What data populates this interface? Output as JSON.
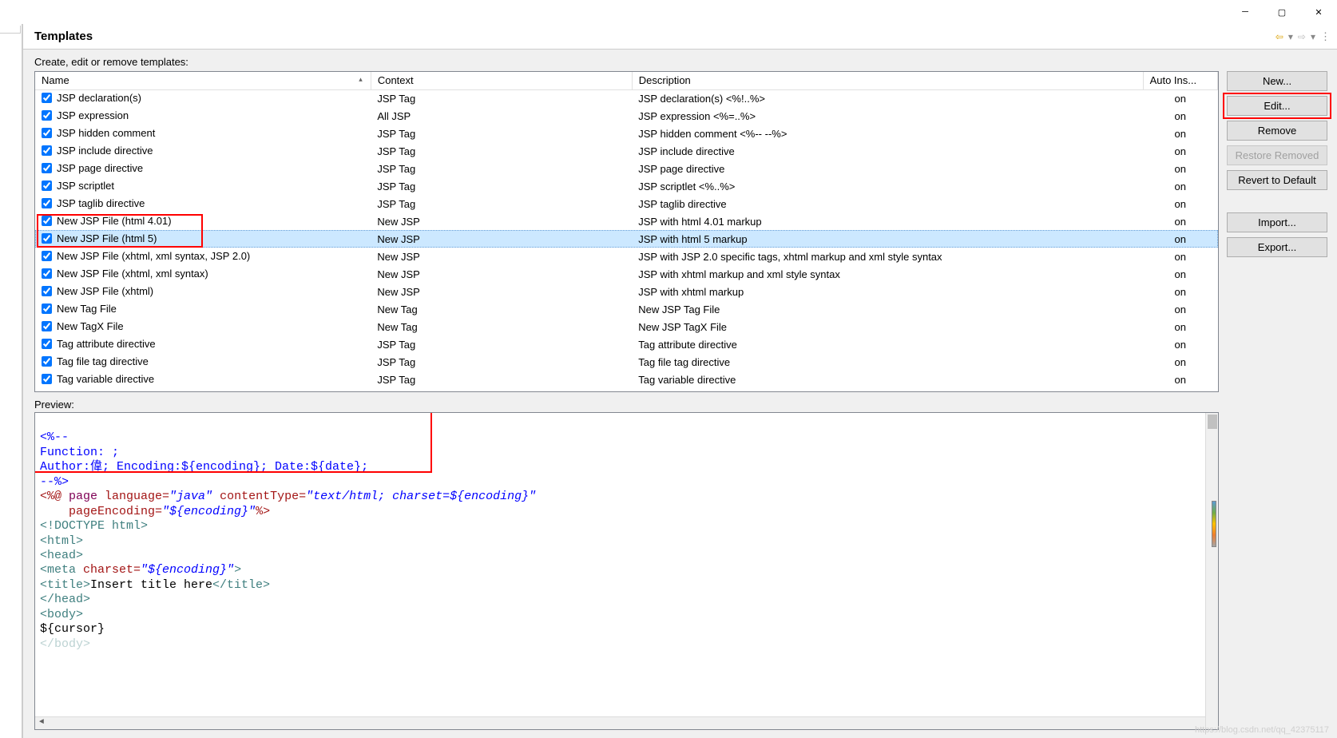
{
  "window": {
    "minimize": "─",
    "maximize": "▢",
    "close": "✕"
  },
  "header": {
    "title": "Templates"
  },
  "instruction": "Create, edit or remove templates:",
  "columns": {
    "name": "Name",
    "context": "Context",
    "description": "Description",
    "autoins": "Auto Ins..."
  },
  "rows": [
    {
      "checked": true,
      "name": "JSP declaration(s)",
      "context": "JSP Tag",
      "description": "JSP declaration(s) <%!..%>",
      "auto": "on",
      "selected": false
    },
    {
      "checked": true,
      "name": "JSP expression",
      "context": "All JSP",
      "description": "JSP expression <%=..%>",
      "auto": "on",
      "selected": false
    },
    {
      "checked": true,
      "name": "JSP hidden comment",
      "context": "JSP Tag",
      "description": "JSP hidden comment <%-- --%>",
      "auto": "on",
      "selected": false
    },
    {
      "checked": true,
      "name": "JSP include directive",
      "context": "JSP Tag",
      "description": "JSP include directive",
      "auto": "on",
      "selected": false
    },
    {
      "checked": true,
      "name": "JSP page directive",
      "context": "JSP Tag",
      "description": "JSP page directive",
      "auto": "on",
      "selected": false
    },
    {
      "checked": true,
      "name": "JSP scriptlet",
      "context": "JSP Tag",
      "description": "JSP scriptlet <%..%>",
      "auto": "on",
      "selected": false
    },
    {
      "checked": true,
      "name": "JSP taglib directive",
      "context": "JSP Tag",
      "description": "JSP taglib directive",
      "auto": "on",
      "selected": false
    },
    {
      "checked": true,
      "name": "New JSP File (html 4.01)",
      "context": "New JSP",
      "description": "JSP with html 4.01 markup",
      "auto": "on",
      "selected": false
    },
    {
      "checked": true,
      "name": "New JSP File (html 5)",
      "context": "New JSP",
      "description": "JSP with html 5 markup",
      "auto": "on",
      "selected": true
    },
    {
      "checked": true,
      "name": "New JSP File (xhtml, xml syntax, JSP 2.0)",
      "context": "New JSP",
      "description": "JSP with JSP 2.0 specific tags, xhtml markup and xml style syntax",
      "auto": "on",
      "selected": false
    },
    {
      "checked": true,
      "name": "New JSP File (xhtml, xml syntax)",
      "context": "New JSP",
      "description": "JSP with xhtml markup and xml style syntax",
      "auto": "on",
      "selected": false
    },
    {
      "checked": true,
      "name": "New JSP File (xhtml)",
      "context": "New JSP",
      "description": "JSP with xhtml markup",
      "auto": "on",
      "selected": false
    },
    {
      "checked": true,
      "name": "New Tag File",
      "context": "New Tag",
      "description": "New JSP Tag File",
      "auto": "on",
      "selected": false
    },
    {
      "checked": true,
      "name": "New TagX File",
      "context": "New Tag",
      "description": "New JSP TagX File",
      "auto": "on",
      "selected": false
    },
    {
      "checked": true,
      "name": "Tag attribute directive",
      "context": "JSP Tag",
      "description": "Tag attribute directive",
      "auto": "on",
      "selected": false
    },
    {
      "checked": true,
      "name": "Tag file tag directive",
      "context": "JSP Tag",
      "description": "Tag file tag directive",
      "auto": "on",
      "selected": false
    },
    {
      "checked": true,
      "name": "Tag variable directive",
      "context": "JSP Tag",
      "description": "Tag variable directive",
      "auto": "on",
      "selected": false
    }
  ],
  "buttons": {
    "new": "New...",
    "edit": "Edit...",
    "remove": "Remove",
    "restore_removed": "Restore Removed",
    "revert": "Revert to Default",
    "import": "Import...",
    "export": "Export..."
  },
  "preview_label": "Preview:",
  "preview": {
    "l1": "<%--",
    "l2": "Function: ;",
    "l3": "Author:偉; Encoding:${encoding}; Date:${date};",
    "l4": "--%>",
    "l5a": "<%@ ",
    "l5b": "page",
    "l5c": " language=",
    "l5d": "\"java\"",
    "l5e": " contentType=",
    "l5f": "\"text/html; charset=${encoding}\"",
    "l6a": "    pageEncoding=",
    "l6b": "\"${encoding}\"",
    "l6c": "%>",
    "l7": "<!DOCTYPE html>",
    "l8": "<html>",
    "l9": "<head>",
    "l10a": "<meta ",
    "l10b": "charset=",
    "l10c": "\"${encoding}\"",
    "l10d": ">",
    "l11a": "<title>",
    "l11b": "Insert title here",
    "l11c": "</title>",
    "l12": "</head>",
    "l13": "<body>",
    "l14": "${cursor}",
    "l15": "</body>"
  },
  "watermark": "https://blog.csdn.net/qq_42375117"
}
